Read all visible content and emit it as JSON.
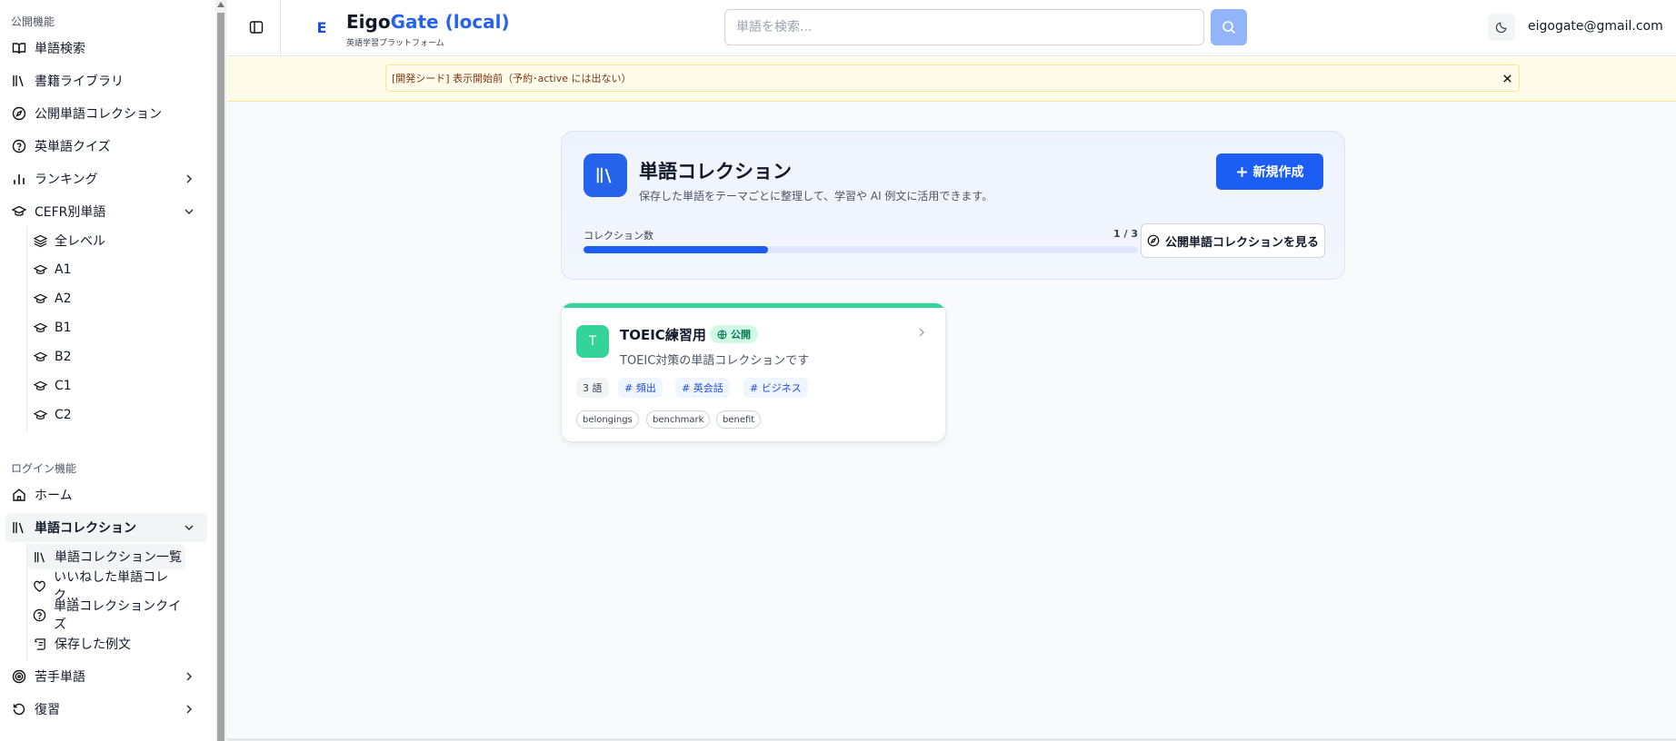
{
  "sidebar": {
    "public_section": "公開機能",
    "login_section": "ログイン機能",
    "items": [
      {
        "label": "単語検索"
      },
      {
        "label": "書籍ライブラリ"
      },
      {
        "label": "公開単語コレクション"
      },
      {
        "label": "英単語クイズ"
      },
      {
        "label": "ランキング"
      },
      {
        "label": "CEFR別単語"
      }
    ],
    "cefr_levels": [
      "全レベル",
      "A1",
      "A2",
      "B1",
      "B2",
      "C1",
      "C2"
    ],
    "login_items": [
      {
        "label": "ホーム"
      },
      {
        "label": "単語コレクション"
      }
    ],
    "collection_sub": [
      "単語コレクション一覧",
      "いいねした単語コレク...",
      "単語コレクションクイズ",
      "保存した例文"
    ],
    "bottom_items": [
      {
        "label": "苦手単語"
      },
      {
        "label": "復習"
      }
    ]
  },
  "header": {
    "logo_letter": "E",
    "brand_part1": "Eigo",
    "brand_part2": "Gate (local)",
    "tagline": "英語学習プラットフォーム",
    "search_placeholder": "単語を検索...",
    "user_email": "eigogate@gmail.com"
  },
  "banner": {
    "text": "[開発シード] 表示開始前（予約･active には出ない）"
  },
  "hero": {
    "title": "単語コレクション",
    "description": "保存した単語をテーマごとに整理して、学習や AI 例文に活用できます。",
    "new_button": "新規作成",
    "count_label": "コレクション数",
    "count_value": "1 / 3",
    "progress": 0.333,
    "public_button": "公開単語コレクションを見る"
  },
  "collections": [
    {
      "avatar": "T",
      "title": "TOEIC練習用",
      "badge": "公開",
      "description": "TOEIC対策の単語コレクションです",
      "word_count": "3 語",
      "tags": [
        "# 頻出",
        "# 英会話",
        "# ビジネス"
      ],
      "words": [
        "belongings",
        "benchmark",
        "benefit"
      ]
    }
  ],
  "colors": {
    "primary": "#1d5ef2",
    "accent_green": "#34d399",
    "banner_bg": "#fefce8"
  }
}
